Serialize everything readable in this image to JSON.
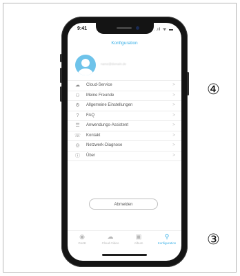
{
  "status": {
    "time": "9:41",
    "icons": "..ıl ᯤ ▬"
  },
  "header": {
    "title": "Konfiguration"
  },
  "profile": {
    "email": "name@domain.de"
  },
  "menu": {
    "chevron": ">",
    "items": [
      {
        "label": "Cloud-Service",
        "icon": "☁"
      },
      {
        "label": "Meine Freunde",
        "icon": "⚇"
      },
      {
        "label": "Allgemeine Einstellungen",
        "icon": "⚙"
      },
      {
        "label": "FAQ",
        "icon": "?"
      },
      {
        "label": "Anwendungs-Assistent",
        "icon": "☰"
      },
      {
        "label": "Kontakt",
        "icon": "☏"
      },
      {
        "label": "Netzwerk-Diagnose",
        "icon": "◎"
      },
      {
        "label": "Über",
        "icon": "ⓘ"
      }
    ]
  },
  "logout": {
    "label": "Abmelden"
  },
  "tabs": [
    {
      "label": "Gerät",
      "icon": "◉"
    },
    {
      "label": "Cloud-Video",
      "icon": "☁"
    },
    {
      "label": "Album",
      "icon": "▣"
    },
    {
      "label": "Konfiguration",
      "icon": "⚲"
    }
  ],
  "callouts": {
    "top": "④",
    "bottom": "③"
  }
}
